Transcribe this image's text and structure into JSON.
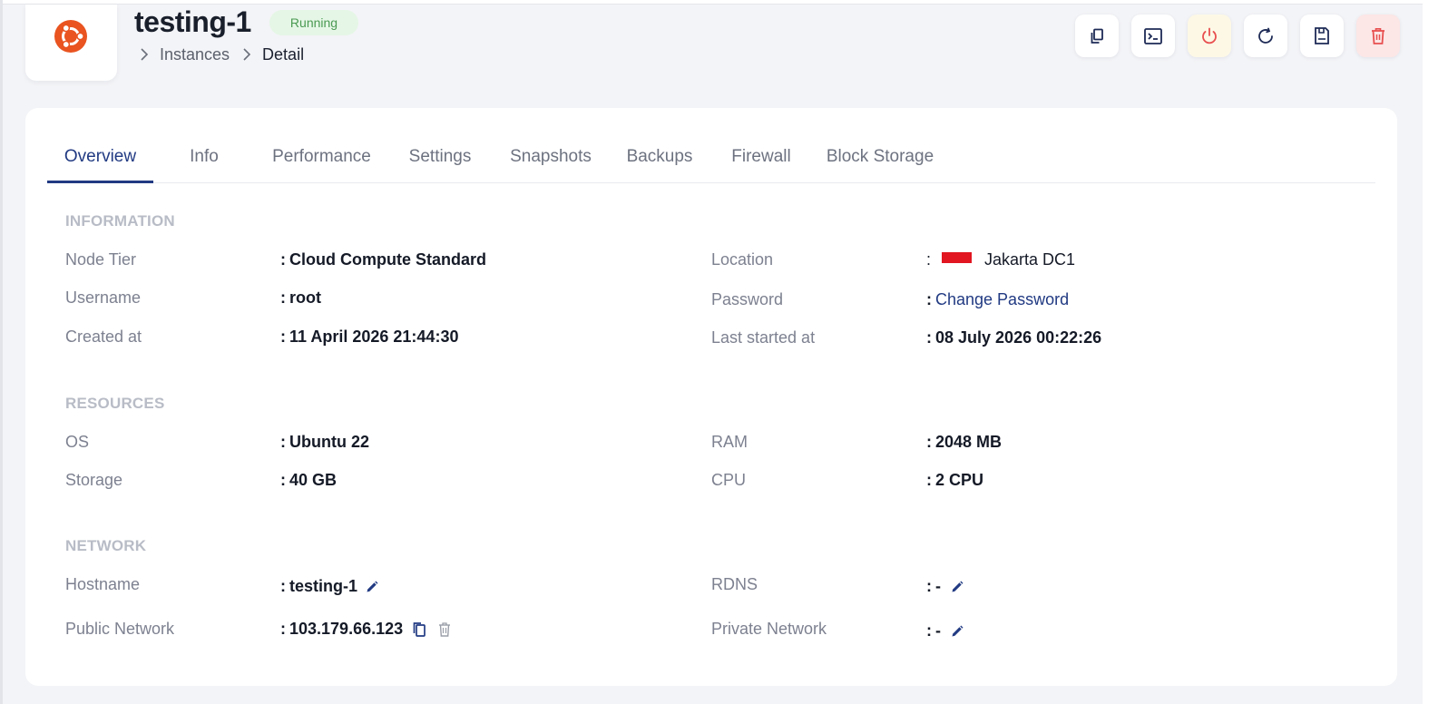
{
  "header": {
    "title": "testing-1",
    "status": "Running",
    "breadcrumb": [
      "Instances",
      "Detail"
    ]
  },
  "actions": [
    {
      "name": "copy-instance-button",
      "icon": "copy-icon"
    },
    {
      "name": "console-button",
      "icon": "terminal-icon"
    },
    {
      "name": "power-button",
      "icon": "power-icon"
    },
    {
      "name": "restart-button",
      "icon": "refresh-icon"
    },
    {
      "name": "snapshot-button",
      "icon": "save-icon"
    },
    {
      "name": "delete-button",
      "icon": "trash-icon"
    }
  ],
  "tabs": [
    "Overview",
    "Info",
    "Performance",
    "Settings",
    "Snapshots",
    "Backups",
    "Firewall",
    "Block Storage"
  ],
  "active_tab": "Overview",
  "sections": {
    "information": {
      "title": "INFORMATION",
      "node_tier": {
        "label": "Node Tier",
        "value": "Cloud Compute Standard"
      },
      "username": {
        "label": "Username",
        "value": "root"
      },
      "created_at": {
        "label": "Created at",
        "value": "11 April 2026 21:44:30"
      },
      "location": {
        "label": "Location",
        "value": "Jakarta DC1"
      },
      "password": {
        "label": "Password",
        "value": "Change Password"
      },
      "last_started_at": {
        "label": "Last started at",
        "value": "08 July 2026 00:22:26"
      }
    },
    "resources": {
      "title": "RESOURCES",
      "os": {
        "label": "OS",
        "value": "Ubuntu 22"
      },
      "storage": {
        "label": "Storage",
        "value": "40 GB"
      },
      "ram": {
        "label": "RAM",
        "value": "2048 MB"
      },
      "cpu": {
        "label": "CPU",
        "value": "2 CPU"
      }
    },
    "network": {
      "title": "NETWORK",
      "hostname": {
        "label": "Hostname",
        "value": "testing-1"
      },
      "public_network": {
        "label": "Public Network",
        "value": "103.179.66.123"
      },
      "rdns": {
        "label": "RDNS",
        "value": "-"
      },
      "private_network": {
        "label": "Private Network",
        "value": "-"
      }
    }
  },
  "colors": {
    "accent": "#213a82",
    "status_bg": "#e5f6e6",
    "status_text": "#4a9a52",
    "danger": "#e84f4f",
    "ubuntu_orange": "#e95420",
    "flag_red": "#e11620"
  }
}
